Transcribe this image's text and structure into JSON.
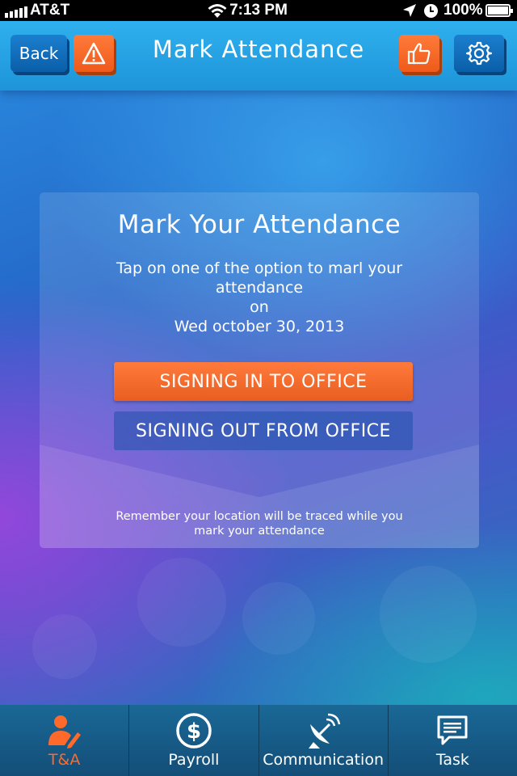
{
  "status_bar": {
    "carrier": "AT&T",
    "time": "7:13 PM",
    "battery": "100%"
  },
  "nav": {
    "back_label": "Back",
    "title": "Mark Attendance",
    "alert_icon": "warning-icon",
    "like_icon": "thumbs-up-icon",
    "settings_icon": "gear-icon"
  },
  "card": {
    "title": "Mark Your Attendance",
    "instruction": "Tap on one of the option to marl your attendance",
    "on_label": "on",
    "date": "Wed october 30, 2013",
    "signin_label": "SIGNING IN TO OFFICE",
    "signout_label": "SIGNING OUT FROM OFFICE",
    "note": "Remember your location will be traced while you mark your attendance"
  },
  "tabs": [
    {
      "label": "T&A",
      "icon": "user-pencil-icon",
      "active": true
    },
    {
      "label": "Payroll",
      "icon": "dollar-icon",
      "active": false
    },
    {
      "label": "Communication",
      "icon": "satellite-dish-icon",
      "active": false
    },
    {
      "label": "Task",
      "icon": "chat-icon",
      "active": false
    }
  ],
  "colors": {
    "accent_orange": "#f26a2a",
    "nav_blue": "#1e94d9",
    "tab_bar": "#134e78"
  }
}
